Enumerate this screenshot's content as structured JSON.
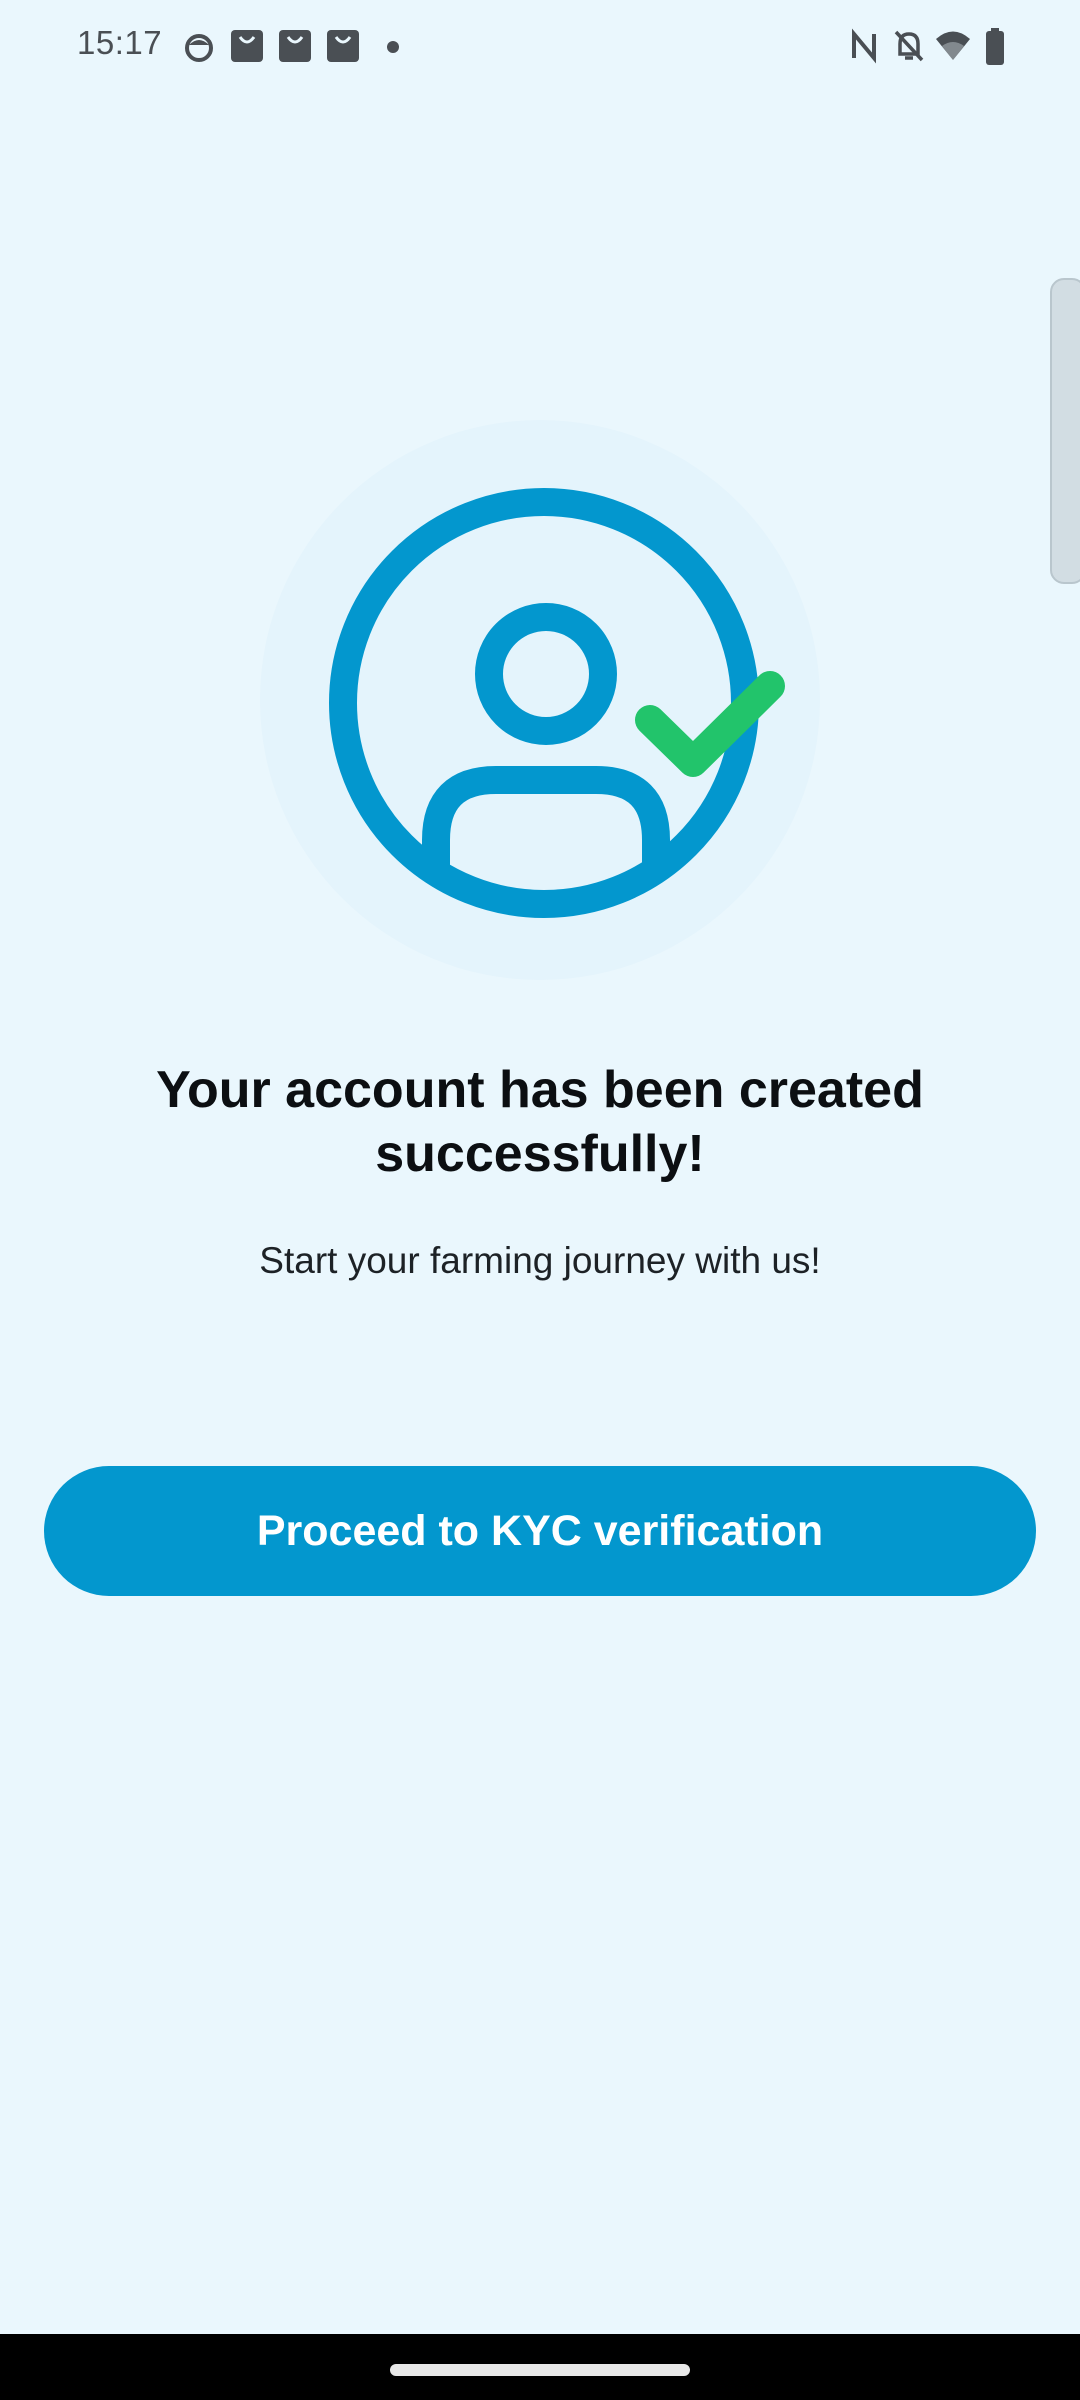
{
  "status_bar": {
    "time": "15:17",
    "left_icons": [
      "face-icon",
      "shopping-bag-icon",
      "shopping-bag-icon",
      "shopping-bag-icon",
      "dot-icon"
    ],
    "right_icons": [
      "nfc-icon",
      "notifications-off-icon",
      "wifi-icon",
      "battery-icon"
    ]
  },
  "main": {
    "illustration_icon": "user-verified-icon",
    "title": "Your account has been created successfully!",
    "subtitle": "Start your farming journey with us!",
    "proceed_button_label": "Proceed to KYC verification"
  },
  "colors": {
    "background": "#EAF7FD",
    "accent": "#0397CE",
    "check": "#22C46B",
    "title_text": "#0C0F12"
  }
}
